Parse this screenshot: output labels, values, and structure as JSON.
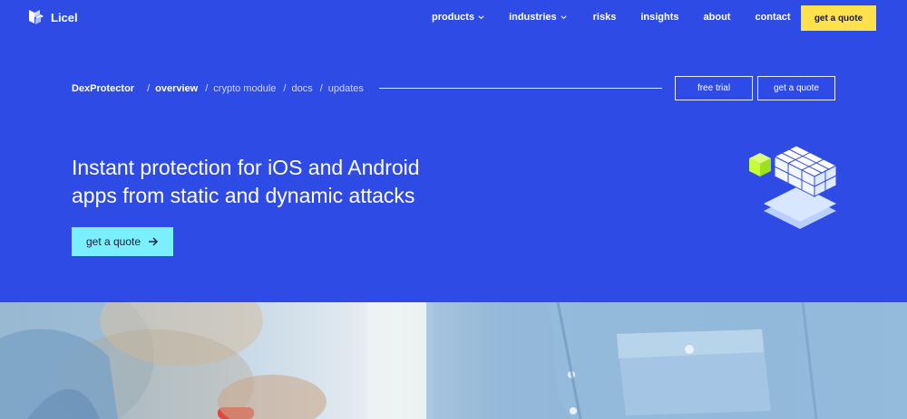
{
  "brand": {
    "name": "Licel"
  },
  "nav": {
    "items": [
      {
        "label": "products",
        "dropdown": true
      },
      {
        "label": "industries",
        "dropdown": true
      },
      {
        "label": "risks",
        "dropdown": false
      },
      {
        "label": "insights",
        "dropdown": false
      },
      {
        "label": "about",
        "dropdown": false
      },
      {
        "label": "contact",
        "dropdown": false
      }
    ],
    "quote_button": "get a quote"
  },
  "subnav": {
    "root": "DexProtector",
    "links": [
      "overview",
      "crypto module",
      "docs",
      "updates"
    ],
    "free_trial": "free trial",
    "get_quote": "get a quote"
  },
  "hero": {
    "headline_line1": "Instant protection for iOS and Android",
    "headline_line2": "apps from static and dynamic attacks",
    "cta": "get a quote"
  },
  "colors": {
    "hero_bg": "#2e4be6",
    "accent_yellow": "#ffe14d",
    "accent_cyan": "#7af0ff",
    "cube_green": "#c6ff3a"
  }
}
